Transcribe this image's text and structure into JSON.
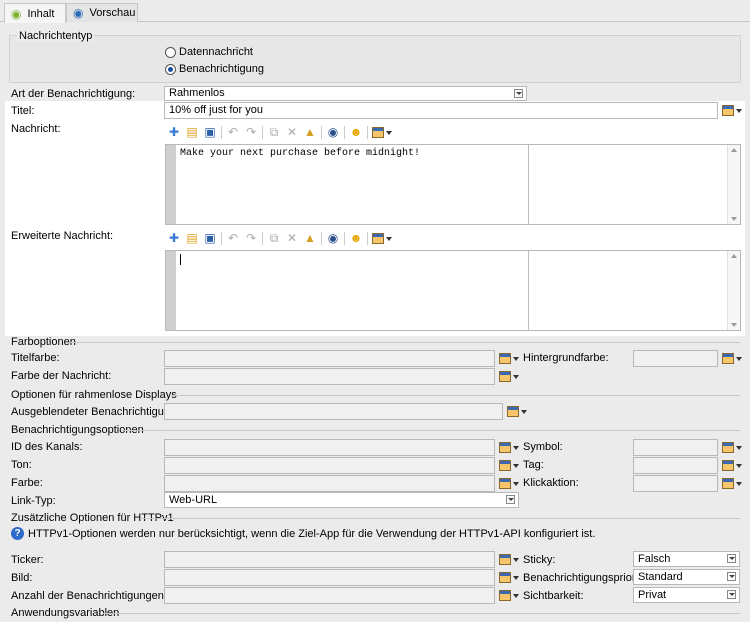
{
  "tabs": [
    {
      "label": "Inhalt",
      "icon": "android-icon"
    },
    {
      "label": "Vorschau",
      "icon": "eye-icon"
    }
  ],
  "nachrichtentyp": {
    "legend": "Nachrichtentyp",
    "options": [
      "Datennachricht",
      "Benachrichtigung"
    ],
    "selected": "Benachrichtigung"
  },
  "art": {
    "label": "Art der Benachrichtigung:",
    "value": "Rahmenlos"
  },
  "titel": {
    "label": "Titel:",
    "value": "10% off just for you"
  },
  "nachricht": {
    "label": "Nachricht:",
    "body": "Make your next purchase before midnight!"
  },
  "erweitert": {
    "label": "Erweiterte Nachricht:",
    "body": ""
  },
  "farboptionen": {
    "legend": "Farboptionen",
    "titelfarbe": "Titelfarbe:",
    "farbe_nachricht": "Farbe der Nachricht:",
    "hintergrundfarbe": "Hintergrundfarbe:"
  },
  "rahmenlos": {
    "legend": "Optionen für rahmenlose Displays",
    "ausgeblendet": "Ausgeblendeter Benachrichtigungsstil:"
  },
  "benachrichtigungsoptionen": {
    "legend": "Benachrichtigungsoptionen",
    "id_kanal": "ID des Kanals:",
    "ton": "Ton:",
    "farbe": "Farbe:",
    "link_typ": "Link-Typ:",
    "link_typ_value": "Web-URL",
    "symbol": "Symbol:",
    "tag": "Tag:",
    "klickaktion": "Klickaktion:"
  },
  "httpv1": {
    "legend": "Zusätzliche Optionen für HTTPv1",
    "info": "HTTPv1-Optionen werden nur berücksichtigt, wenn die Ziel-App für die Verwendung der HTTPv1-API konfiguriert ist.",
    "ticker": "Ticker:",
    "bild": "Bild:",
    "anzahl": "Anzahl der Benachrichtigungen:",
    "sticky": "Sticky:",
    "sticky_value": "Falsch",
    "prioritaet": "Benachrichtigungspriorität:",
    "prioritaet_value": "Standard",
    "sichtbarkeit": "Sichtbarkeit:",
    "sichtbarkeit_value": "Privat"
  },
  "anwendungsvariablen": {
    "legend": "Anwendungsvariablen"
  }
}
